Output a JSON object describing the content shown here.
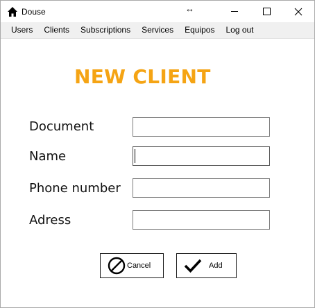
{
  "window": {
    "title": "Douse",
    "icons": {
      "app": "home-icon",
      "resize": "resize-horizontal-icon"
    }
  },
  "menu": [
    {
      "label": "Users"
    },
    {
      "label": "Clients"
    },
    {
      "label": "Subscriptions"
    },
    {
      "label": "Services"
    },
    {
      "label": "Equipos"
    },
    {
      "label": "Log out"
    }
  ],
  "form": {
    "heading": "NEW CLIENT",
    "heading_color": "#f5a414",
    "fields": [
      {
        "label": "Document",
        "value": ""
      },
      {
        "label": "Name",
        "value": ""
      },
      {
        "label": "Phone number",
        "value": ""
      },
      {
        "label": "Adress",
        "value": ""
      }
    ],
    "buttons": {
      "cancel": {
        "label": "Cancel",
        "icon": "cancel-icon"
      },
      "add": {
        "label": "Add",
        "icon": "checkmark-icon"
      }
    }
  }
}
